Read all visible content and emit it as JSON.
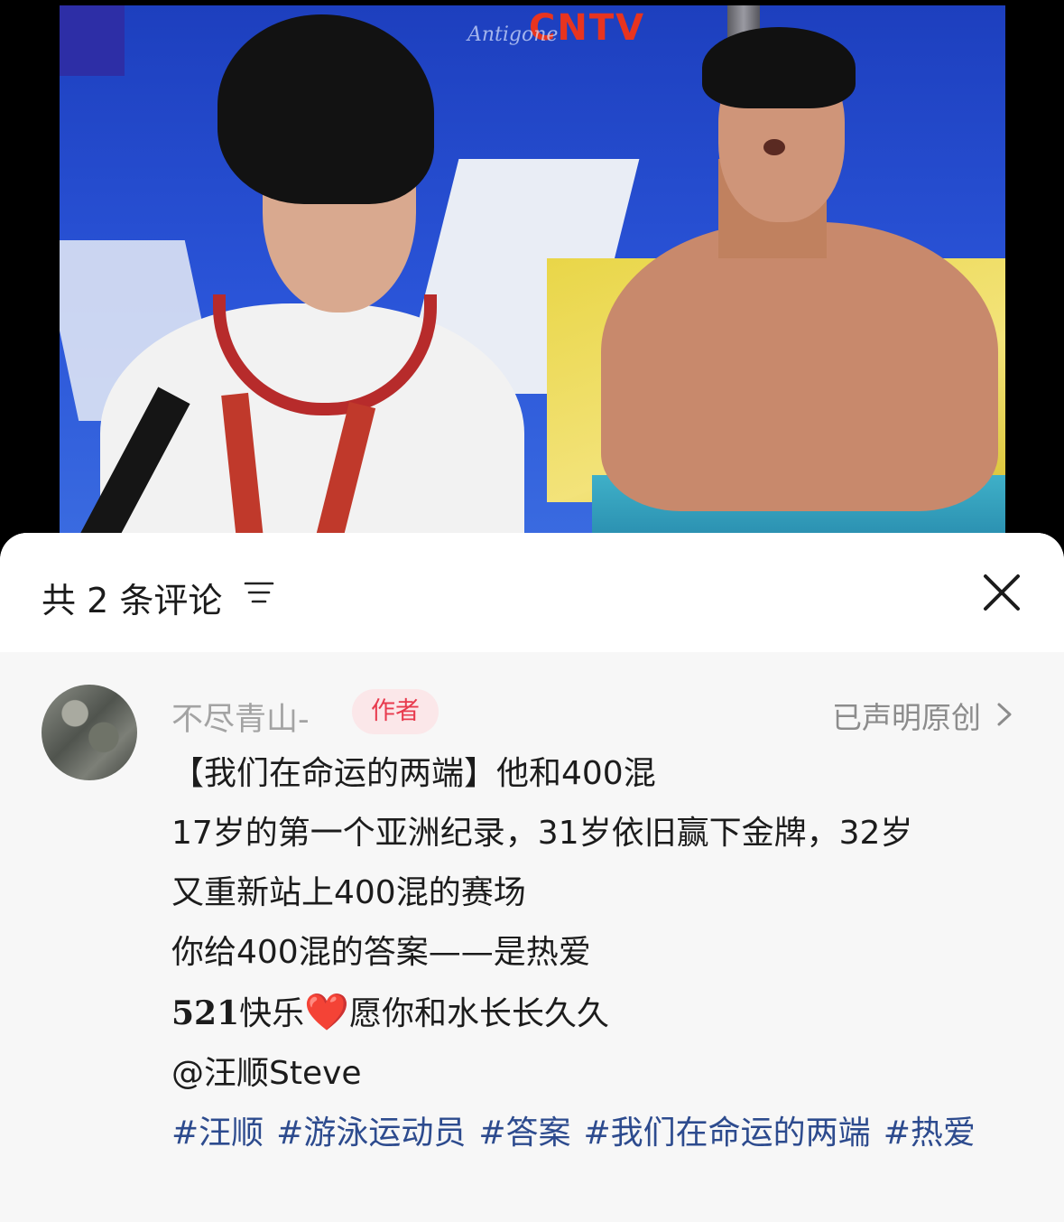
{
  "video": {
    "channel_logo": "CNTV",
    "watermark": "Antigone"
  },
  "header": {
    "comment_count_label": "共 2 条评论",
    "sort_icon": "sort-lines-icon",
    "close_icon": "close-x-icon"
  },
  "comment": {
    "username": "不尽青山-",
    "badge": "作者",
    "original_label": "已声明原创",
    "lines": [
      "【我们在命运的两端】他和400混",
      "17岁的第一个亚洲纪录，31岁依旧赢下金牌，32岁",
      "又重新站上400混的赛场",
      "你给400混的答案——是热爱"
    ],
    "line5_number": "521",
    "line5_text_a": "快乐",
    "line5_emoji": "❤️",
    "line5_text_b": "愿你和水长长久久",
    "mention": "@汪顺Steve",
    "hashtags": [
      "#汪顺",
      "#游泳运动员",
      "#答案",
      "#我们在命运的两端",
      "#热爱"
    ]
  },
  "colors": {
    "hashtag": "#2d4b8e",
    "badge_text": "#e83b4e",
    "badge_bg": "#fbe7e9",
    "comment_bg": "#f7f7f7"
  }
}
